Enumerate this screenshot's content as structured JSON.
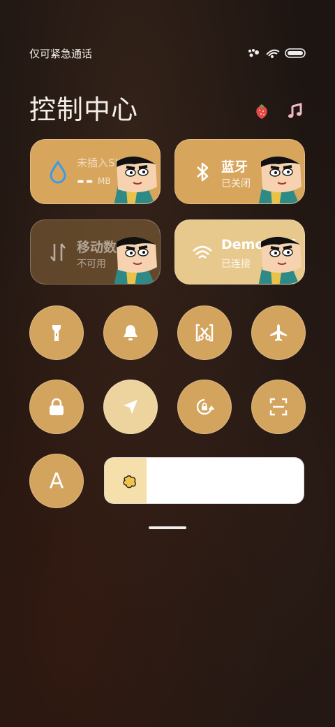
{
  "status": {
    "carrier": "仅可紧急通话"
  },
  "header": {
    "title": "控制中心"
  },
  "tiles": {
    "data": {
      "title": "未插入SIM卡",
      "value": "--",
      "unit": "MB"
    },
    "bluetooth": {
      "title": "蓝牙",
      "status": "已关闭"
    },
    "mobile": {
      "title": "移动数据",
      "status": "不可用"
    },
    "wifi": {
      "title": "DemoMod",
      "status": "已连接"
    }
  },
  "buttons": {
    "flashlight": "flashlight-icon",
    "bell": "bell-icon",
    "screenshot": "screenshot-icon",
    "airplane": "airplane-icon",
    "lock": "lock-icon",
    "location": "location-icon",
    "rotation": "rotation-lock-icon",
    "scan": "scan-icon",
    "font": "A"
  },
  "brightness": {
    "level": 0.21
  },
  "colors": {
    "accent": "#d3a45e",
    "accent_light": "#edd49f",
    "background": "#1d1512"
  }
}
